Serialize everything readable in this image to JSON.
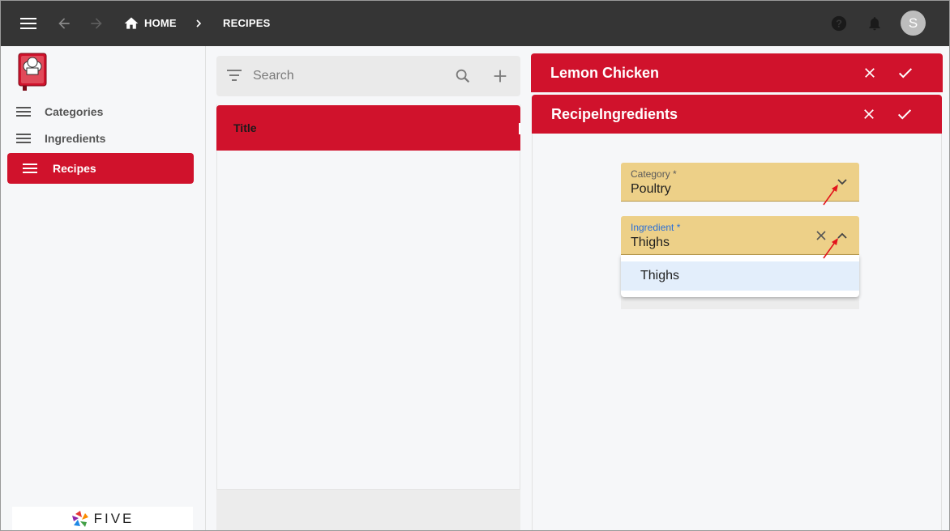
{
  "topbar": {
    "breadcrumb_home": "HOME",
    "breadcrumb_current": "RECIPES",
    "avatar_letter": "S"
  },
  "sidebar": {
    "items": [
      {
        "label": "Categories"
      },
      {
        "label": "Ingredients"
      },
      {
        "label": "Recipes"
      }
    ],
    "footer_logo": "FIVE"
  },
  "list": {
    "search_placeholder": "Search",
    "column_header": "Title"
  },
  "recipe_form": {
    "title": "Lemon Chicken"
  },
  "ingredient_form": {
    "title": "RecipeIngredients",
    "category": {
      "label": "Category *",
      "value": "Poultry"
    },
    "ingredient": {
      "label": "Ingredient *",
      "value": "Thighs"
    },
    "dropdown_options": [
      "Thighs"
    ]
  },
  "colors": {
    "topbar": "#353535",
    "accent": "#d0122c",
    "field_bg": "#edd088",
    "option_highlight": "#e3eefb",
    "focus_label": "#2a6fd8"
  }
}
